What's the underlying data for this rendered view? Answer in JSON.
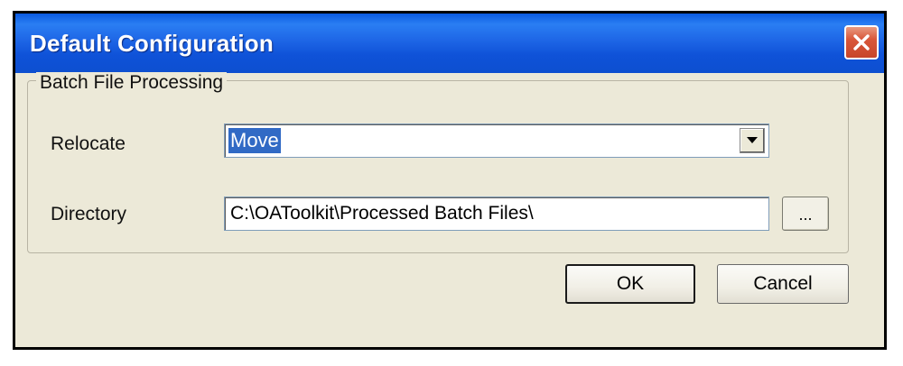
{
  "window": {
    "title": "Default Configuration",
    "close_icon": "close-icon"
  },
  "group": {
    "label": "Batch File Processing"
  },
  "relocate": {
    "label": "Relocate",
    "selected_value": "Move",
    "arrow_icon": "chevron-down-icon"
  },
  "directory": {
    "label": "Directory",
    "value": "C:\\OAToolkit\\Processed Batch Files\\",
    "browse_label": "..."
  },
  "buttons": {
    "ok_label": "OK",
    "cancel_label": "Cancel"
  },
  "colors": {
    "titlebar": "#0f52d8",
    "close_button": "#d9573a",
    "dialog_background": "#ece9d8",
    "selection_highlight": "#316ac5"
  }
}
